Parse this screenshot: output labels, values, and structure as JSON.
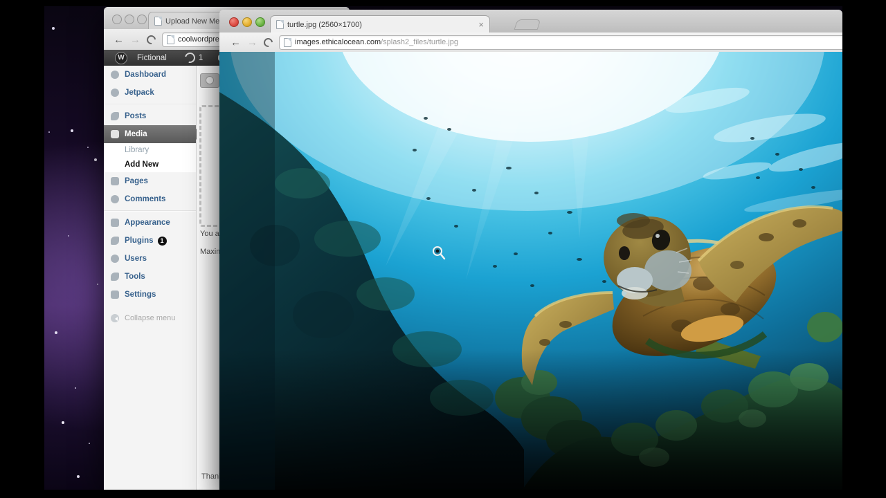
{
  "wp": {
    "tab_title": "Upload New Medi",
    "url": "coolwordpre",
    "admin": {
      "logo_glyph": "W",
      "site": "Fictional",
      "updates": "1"
    },
    "sidebar": {
      "items": [
        {
          "label": "Dashboard"
        },
        {
          "label": "Jetpack"
        },
        {
          "label": "Posts"
        },
        {
          "label": "Media"
        },
        {
          "label": "Library"
        },
        {
          "label": "Add New"
        },
        {
          "label": "Pages"
        },
        {
          "label": "Comments"
        },
        {
          "label": "Appearance"
        },
        {
          "label": "Plugins",
          "badge": "1"
        },
        {
          "label": "Users"
        },
        {
          "label": "Tools"
        },
        {
          "label": "Settings"
        }
      ],
      "collapse": "Collapse menu"
    },
    "content": {
      "notice_line1": "You a",
      "notice_line2": "Maxim",
      "footer_text": "Thank"
    }
  },
  "cr": {
    "tab_title": "turtle.jpg (2560×1700)",
    "tab_close": "×",
    "url_host": "images.ethicalocean.com",
    "url_path": "/splash2_files/turtle.jpg"
  },
  "icons": {
    "back_arrow": "←",
    "forward_arrow": "→"
  },
  "colors": {
    "traffic_red": "#dd4b42",
    "traffic_yellow": "#e5af2f",
    "traffic_green": "#6cb445",
    "wp_admin_bar": "#3a3a3a",
    "sidebar_link_blue": "#37618c",
    "ocean_cyan": "#35c3e8",
    "reef_teal": "#0b333c"
  }
}
